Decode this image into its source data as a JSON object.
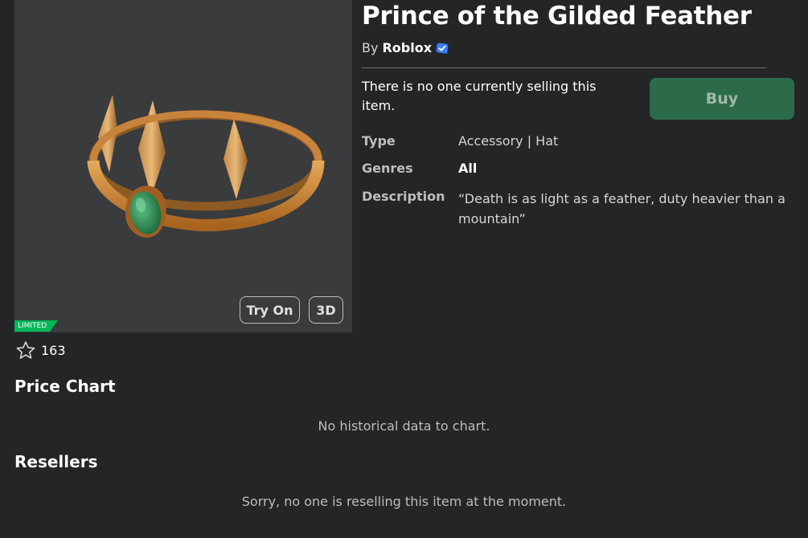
{
  "item": {
    "title": "Prince of the Gilded Feather",
    "by_prefix": "By",
    "creator": "Roblox",
    "creator_verified": true,
    "badge": "LIMITED",
    "favorites": "163",
    "try_on_label": "Try On",
    "view_3d_label": "3D"
  },
  "purchase": {
    "status_text": "There is no one currently selling this item.",
    "buy_label": "Buy"
  },
  "details": {
    "type_label": "Type",
    "type_value": "Accessory | Hat",
    "genres_label": "Genres",
    "genres_value": "All",
    "description_label": "Description",
    "description_value": "“Death is as light as a feather, duty heavier than a mountain”"
  },
  "price_chart": {
    "title": "Price Chart",
    "empty_text": "No historical data to chart."
  },
  "resellers": {
    "title": "Resellers",
    "empty_text": "Sorry, no one is reselling this item at the moment."
  },
  "colors": {
    "background": "#232527",
    "thumbnail_bg": "#393b3d",
    "buy_button": "#2c6b4a",
    "limited_badge": "#02b757",
    "verified_badge": "#3b7bff"
  },
  "icons": {
    "verified": "verified-badge-icon",
    "favorite": "star-outline-icon"
  }
}
